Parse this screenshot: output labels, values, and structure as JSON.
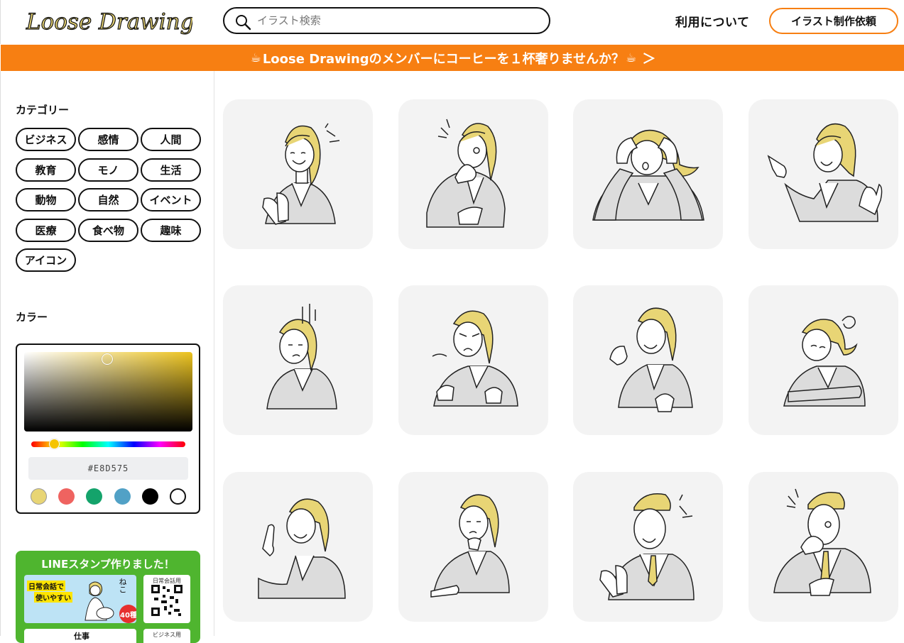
{
  "header": {
    "logo_text": "Loose Drawing",
    "search_placeholder": "イラスト検索",
    "nav_link": "利用について",
    "request_button": "イラスト制作依頼"
  },
  "banner": {
    "text": "Loose Drawingのメンバーにコーヒーを１杯奢りませんか？",
    "cup_left": "☕",
    "cup_right": "☕",
    "arrow": "＞"
  },
  "sidebar": {
    "categories_title": "カテゴリー",
    "categories": [
      "ビジネス",
      "感情",
      "人間",
      "教育",
      "モノ",
      "生活",
      "動物",
      "自然",
      "イベント",
      "医療",
      "食べ物",
      "趣味",
      "アイコン"
    ],
    "color_title": "カラー",
    "color_hex": "#E8D575",
    "swatches": [
      "#e8d575",
      "#ef6360",
      "#14a36b",
      "#51a1c6",
      "#000000",
      "#ffffff"
    ],
    "line_promo": {
      "title": "LINEスタンプ作りました！",
      "stamp1_line1": "日常会話で",
      "stamp1_line2": "使いやすい",
      "stamp1_neko": "ねこ",
      "stamp1_badge": "40種",
      "qr1_label": "日常会話用",
      "stamp2_text": "仕事",
      "qr2_label": "ビジネス用"
    }
  },
  "accent_color": "#f77f12",
  "illustrations": [
    {
      "name": "woman-refusing-gesture",
      "emotion": "refuse"
    },
    {
      "name": "woman-surprised-thinking",
      "emotion": "surprise"
    },
    {
      "name": "woman-headache-confused",
      "emotion": "trouble"
    },
    {
      "name": "woman-pointing",
      "emotion": "point"
    },
    {
      "name": "woman-depressed",
      "emotion": "sad"
    },
    {
      "name": "woman-angry-arms",
      "emotion": "angry"
    },
    {
      "name": "woman-fist-determined",
      "emotion": "motivated"
    },
    {
      "name": "woman-tired-arms-crossed",
      "emotion": "tired"
    },
    {
      "name": "woman-idea-finger-up",
      "emotion": "idea"
    },
    {
      "name": "woman-pondering-pointing",
      "emotion": "ponder"
    },
    {
      "name": "man-refusing-gesture",
      "emotion": "refuse"
    },
    {
      "name": "man-surprised-thinking",
      "emotion": "surprise"
    }
  ]
}
